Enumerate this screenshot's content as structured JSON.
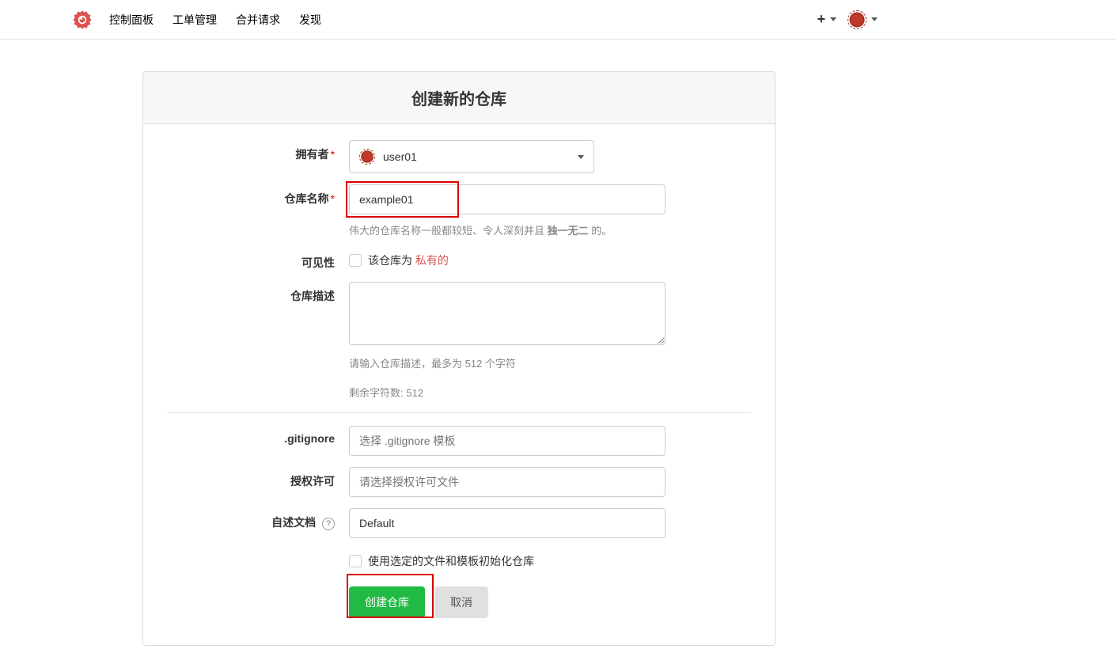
{
  "nav": {
    "links": [
      "控制面板",
      "工单管理",
      "合并请求",
      "发现"
    ]
  },
  "panel": {
    "title": "创建新的仓库"
  },
  "form": {
    "owner": {
      "label": "拥有者",
      "value": "user01"
    },
    "repo_name": {
      "label": "仓库名称",
      "value": "example01",
      "help": "伟大的仓库名称一般都较短、令人深刻并且",
      "help_strong": "独一无二",
      "help_tail": "的。"
    },
    "visibility": {
      "label": "可见性",
      "text_prefix": "该仓库为",
      "text_private": "私有的"
    },
    "description": {
      "label": "仓库描述",
      "value": "",
      "help1": "请输入仓库描述，最多为 512 个字符",
      "help2_prefix": "剩余字符数:",
      "help2_count": "512"
    },
    "gitignore": {
      "label": ".gitignore",
      "placeholder": "选择 .gitignore 模板"
    },
    "license": {
      "label": "授权许可",
      "placeholder": "请选择授权许可文件"
    },
    "readme": {
      "label": "自述文档",
      "value": "Default"
    },
    "init_checkbox": {
      "label": "使用选定的文件和模板初始化仓库"
    },
    "buttons": {
      "create": "创建仓库",
      "cancel": "取消"
    }
  }
}
